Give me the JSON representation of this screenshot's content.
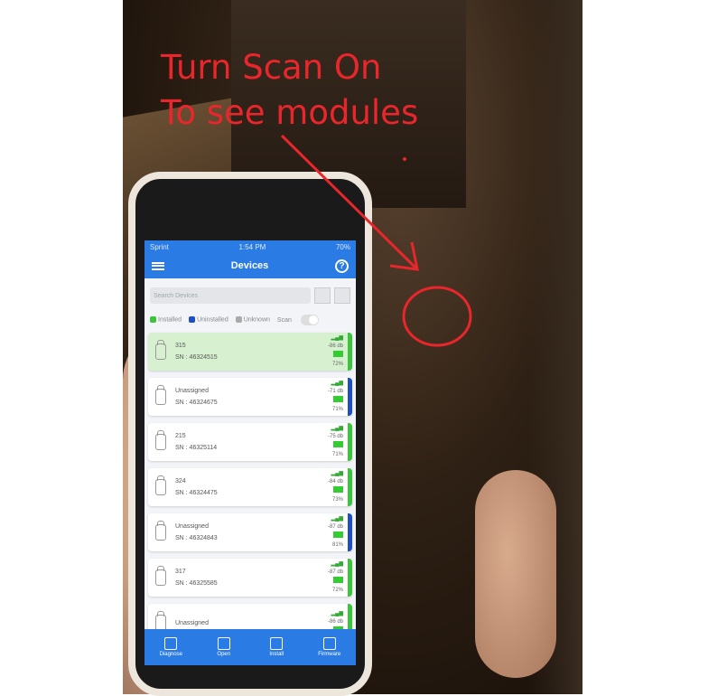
{
  "annotation": {
    "line1": "Turn Scan On",
    "line2": "To see modules",
    "color": "#e8262b"
  },
  "statusbar": {
    "carrier": "Sprint",
    "time": "1:54 PM",
    "battery": "70%"
  },
  "appbar": {
    "title": "Devices",
    "menu_icon": "menu-icon",
    "help_icon": "help-icon",
    "help_glyph": "?"
  },
  "search": {
    "placeholder": "Search Devices"
  },
  "legend": {
    "installed": "Installed",
    "uninstalled": "Uninstalled",
    "unknown": "Unknown",
    "scan_label": "Scan",
    "colors": {
      "installed": "#3cc43c",
      "uninstalled": "#1f4fc4",
      "unknown": "#aaaaaa"
    }
  },
  "devices": [
    {
      "name": "315",
      "sn": "SN : 46324515",
      "signal": "-86 db",
      "battery": "72%",
      "status": "installed",
      "highlight": true
    },
    {
      "name": "Unassigned",
      "sn": "SN : 46324675",
      "signal": "-71 db",
      "battery": "71%",
      "status": "uninstalled",
      "highlight": false
    },
    {
      "name": "215",
      "sn": "SN : 46325114",
      "signal": "-75 db",
      "battery": "71%",
      "status": "installed",
      "highlight": false
    },
    {
      "name": "324",
      "sn": "SN : 46324475",
      "signal": "-84 db",
      "battery": "73%",
      "status": "installed",
      "highlight": false
    },
    {
      "name": "Unassigned",
      "sn": "SN : 46324843",
      "signal": "-87 db",
      "battery": "81%",
      "status": "uninstalled",
      "highlight": false
    },
    {
      "name": "317",
      "sn": "SN : 46325585",
      "signal": "-87 db",
      "battery": "72%",
      "status": "installed",
      "highlight": false
    },
    {
      "name": "Unassigned",
      "sn": "",
      "signal": "-86 db",
      "battery": "",
      "status": "installed",
      "highlight": false
    }
  ],
  "tabs": [
    {
      "label": "Diagnose",
      "icon": "diagnose-icon"
    },
    {
      "label": "Open",
      "icon": "open-icon"
    },
    {
      "label": "Install",
      "icon": "install-icon"
    },
    {
      "label": "Firmware",
      "icon": "firmware-icon"
    }
  ]
}
